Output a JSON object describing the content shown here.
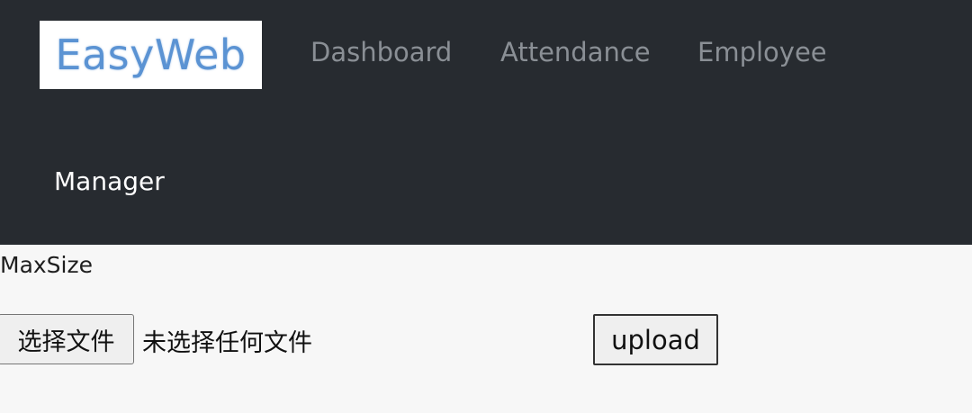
{
  "navbar": {
    "brand": "EasyWeb",
    "links": [
      {
        "label": "Dashboard"
      },
      {
        "label": "Attendance"
      },
      {
        "label": "Employee"
      },
      {
        "label": "Manager"
      }
    ]
  },
  "form": {
    "maxsize_label": "MaxSize",
    "file_button_label": "选择文件",
    "file_status": "未选择任何文件",
    "upload_label": "upload"
  },
  "colors": {
    "navbar_bg": "#272b30",
    "brand_text": "#5b93d3",
    "nav_link": "#8a8f95",
    "nav_link_active": "#ffffff",
    "page_bg": "#f7f7f7"
  }
}
